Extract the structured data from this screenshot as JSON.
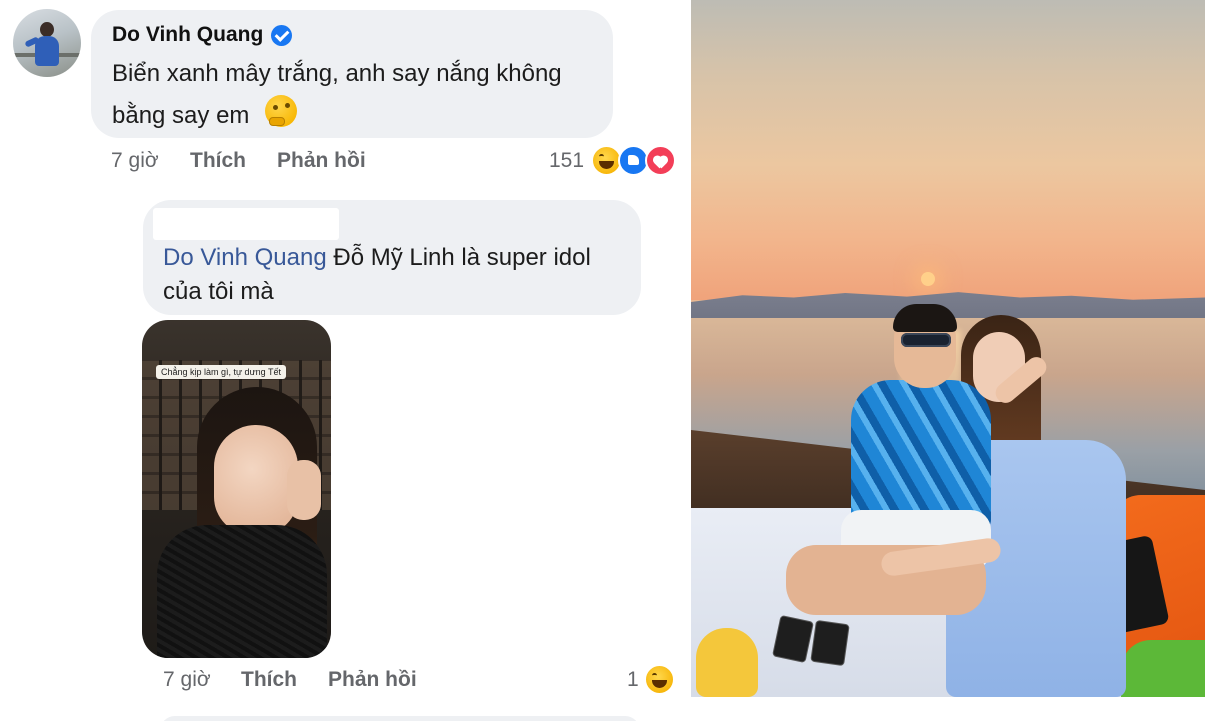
{
  "comment": {
    "author": "Do Vinh Quang",
    "text": "Biển xanh mây trắng, anh say nắng không bằng say em",
    "emoji": "thinking-face-emoji",
    "time": "7 giờ",
    "like_label": "Thích",
    "reply_label": "Phản hồi",
    "reaction_count": "151",
    "reactions": [
      "haha-reaction-icon",
      "like-reaction-icon",
      "love-reaction-icon"
    ]
  },
  "reply": {
    "mention": "Do Vinh Quang",
    "text": "Đỗ Mỹ Linh là super idol của tôi mà",
    "image_caption": "Chẳng kịp làm gì, tự dưng Tết",
    "time": "7 giờ",
    "like_label": "Thích",
    "reply_label": "Phản hồi",
    "reaction_count": "1",
    "reactions": [
      "haha-reaction-icon"
    ]
  },
  "colors": {
    "bubble": "#eef0f3",
    "mention": "#385898",
    "meta": "#65676b",
    "verified": "#1877f2"
  }
}
